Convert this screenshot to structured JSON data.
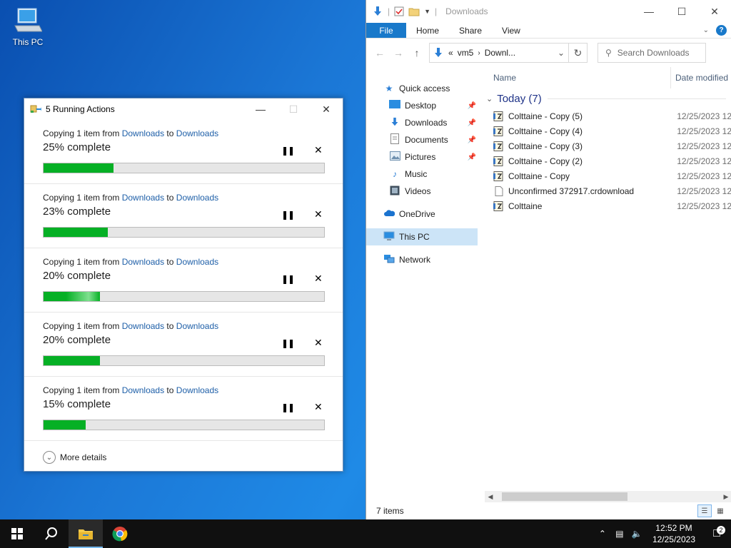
{
  "desktop": {
    "this_pc_label": "This PC"
  },
  "dialog": {
    "title": "5 Running Actions",
    "operations": [
      {
        "prefix": "Copying 1 item from ",
        "from": "Downloads",
        "mid": " to ",
        "to": "Downloads",
        "percent_text": "25% complete",
        "progress": 25
      },
      {
        "prefix": "Copying 1 item from ",
        "from": "Downloads",
        "mid": " to ",
        "to": "Downloads",
        "percent_text": "23% complete",
        "progress": 23
      },
      {
        "prefix": "Copying 1 item from ",
        "from": "Downloads",
        "mid": " to ",
        "to": "Downloads",
        "percent_text": "20% complete",
        "progress": 20
      },
      {
        "prefix": "Copying 1 item from ",
        "from": "Downloads",
        "mid": " to ",
        "to": "Downloads",
        "percent_text": "20% complete",
        "progress": 20
      },
      {
        "prefix": "Copying 1 item from ",
        "from": "Downloads",
        "mid": " to ",
        "to": "Downloads",
        "percent_text": "15% complete",
        "progress": 15
      }
    ],
    "more_details": "More details",
    "progress_color": "#06b025"
  },
  "explorer": {
    "title": "Downloads",
    "ribbon": {
      "file": "File",
      "home": "Home",
      "share": "Share",
      "view": "View"
    },
    "address": {
      "overflow": "«",
      "part1": "vm5",
      "part2": "Downl..."
    },
    "search_placeholder": "Search Downloads",
    "nav": {
      "quick_access": "Quick access",
      "desktop": "Desktop",
      "downloads": "Downloads",
      "documents": "Documents",
      "pictures": "Pictures",
      "music": "Music",
      "videos": "Videos",
      "onedrive": "OneDrive",
      "this_pc": "This PC",
      "network": "Network"
    },
    "columns": {
      "name": "Name",
      "date": "Date modified"
    },
    "group": "Today (7)",
    "files": [
      {
        "name": "Colttaine - Copy (5)",
        "date": "12/25/2023 12",
        "icon": "text-doc-icon"
      },
      {
        "name": "Colttaine - Copy (4)",
        "date": "12/25/2023 12",
        "icon": "text-doc-icon"
      },
      {
        "name": "Colttaine - Copy (3)",
        "date": "12/25/2023 12",
        "icon": "text-doc-icon"
      },
      {
        "name": "Colttaine - Copy (2)",
        "date": "12/25/2023 12",
        "icon": "text-doc-icon"
      },
      {
        "name": "Colttaine - Copy",
        "date": "12/25/2023 12",
        "icon": "text-doc-icon"
      },
      {
        "name": "Unconfirmed 372917.crdownload",
        "date": "12/25/2023 12",
        "icon": "blank-file-icon"
      },
      {
        "name": "Colttaine",
        "date": "12/25/2023 12",
        "icon": "text-doc-icon"
      }
    ],
    "status": "7 items"
  },
  "taskbar": {
    "time": "12:52 PM",
    "date": "12/25/2023",
    "notification_count": "2"
  }
}
